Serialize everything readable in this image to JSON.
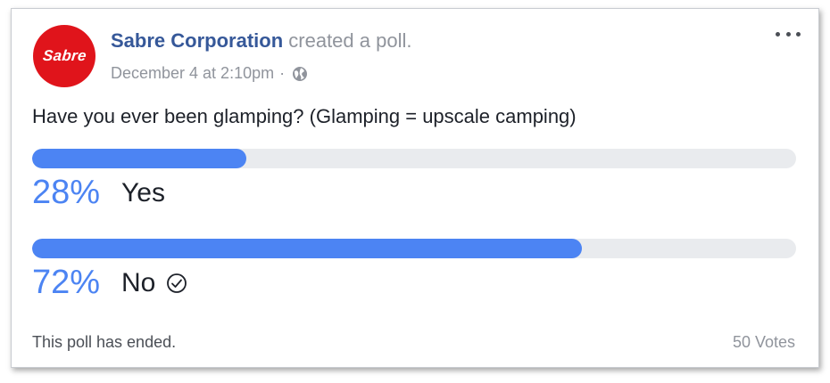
{
  "post": {
    "author": "Sabre Corporation",
    "action": "created a poll.",
    "timestamp": "December 4 at 2:10pm",
    "separator": "·",
    "privacy_icon": "globe-icon",
    "avatar_text": "Sabre",
    "avatar_color": "#e0141b",
    "more_icon": "more-options-icon"
  },
  "poll": {
    "question": "Have you ever been glamping? (Glamping = upscale camping)",
    "bar_color": "#4c84f3",
    "track_color": "#e9ebee",
    "options": [
      {
        "percent_label": "28%",
        "percent": 28,
        "label": "Yes",
        "selected": false
      },
      {
        "percent_label": "72%",
        "percent": 72,
        "label": "No",
        "selected": true
      }
    ],
    "status": "This poll has ended.",
    "votes": "50 Votes"
  }
}
